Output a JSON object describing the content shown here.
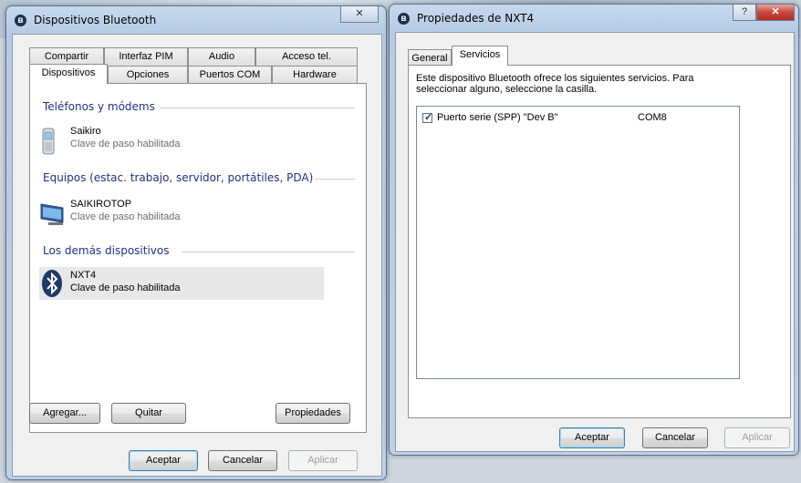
{
  "left_window": {
    "title": "Dispositivos Bluetooth",
    "close_glyph": "✕",
    "tabs_row1": [
      "Compartir",
      "Interfaz PIM",
      "Audio",
      "Acceso tel."
    ],
    "tabs_row2": [
      "Dispositivos",
      "Opciones",
      "Puertos COM",
      "Hardware"
    ],
    "groups": {
      "phones": "Teléfonos y módems",
      "computers": "Equipos (estac. trabajo, servidor, portátiles, PDA)",
      "others": "Los demás dispositivos"
    },
    "devices": [
      {
        "name": "Saikiro",
        "status": "Clave de paso habilitada",
        "icon": "mobile-phone-icon"
      },
      {
        "name": "SAIKIROTOP",
        "status": "Clave de paso habilitada",
        "icon": "computer-monitor-icon"
      },
      {
        "name": "NXT4",
        "status": "Clave de paso habilitada",
        "icon": "bluetooth-icon"
      }
    ],
    "buttons": {
      "add": "Agregar...",
      "remove": "Quitar",
      "properties": "Propiedades",
      "ok": "Aceptar",
      "cancel": "Cancelar",
      "apply": "Aplicar"
    }
  },
  "right_window": {
    "title": "Propiedades de NXT4",
    "help_glyph": "?",
    "close_glyph": "✕",
    "tabs": [
      "General",
      "Servicios"
    ],
    "description": "Este dispositivo Bluetooth ofrece los siguientes servicios. Para seleccionar alguno, seleccione la casilla.",
    "services": [
      {
        "name": "Puerto serie (SPP) \"Dev B\"",
        "port": "COM8",
        "checked": true
      }
    ],
    "buttons": {
      "ok": "Aceptar",
      "cancel": "Cancelar",
      "apply": "Aplicar"
    }
  },
  "colors": {
    "group_heading": "#1e3287",
    "selected_row": "#e8e8e8",
    "close_button": "#c9473a"
  }
}
